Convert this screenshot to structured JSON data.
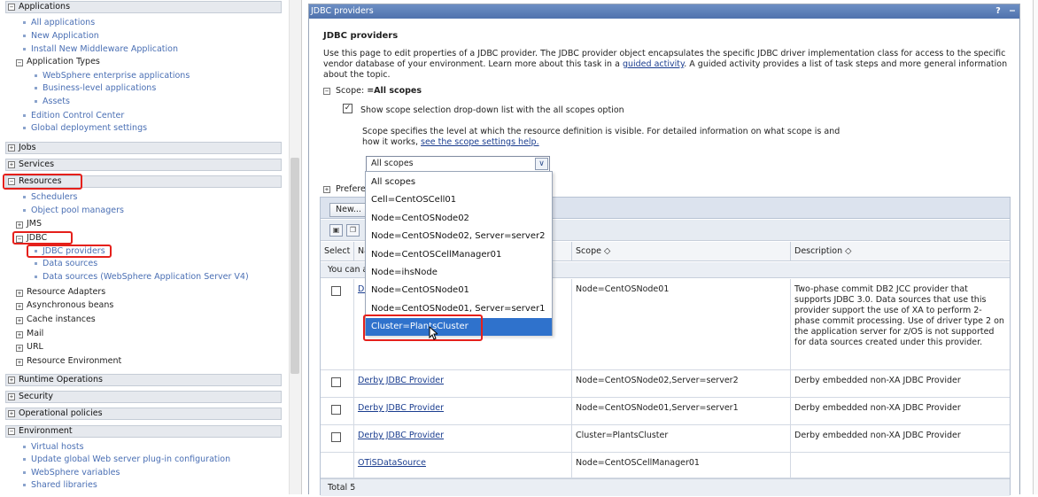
{
  "nav": {
    "applications": {
      "label": "Applications",
      "items": [
        "All applications",
        "New Application",
        "Install New Middleware Application"
      ],
      "app_types": {
        "label": "Application Types",
        "items": [
          "WebSphere enterprise applications",
          "Business-level applications",
          "Assets"
        ]
      },
      "more": [
        "Edition Control Center",
        "Global deployment settings"
      ]
    },
    "jobs": "Jobs",
    "services": "Services",
    "resources": {
      "label": "Resources",
      "items": [
        "Schedulers",
        "Object pool managers"
      ],
      "jms": "JMS",
      "jdbc": {
        "label": "JDBC",
        "items": [
          "JDBC providers",
          "Data sources",
          "Data sources (WebSphere Application Server V4)"
        ]
      },
      "groups": [
        "Resource Adapters",
        "Asynchronous beans",
        "Cache instances",
        "Mail",
        "URL",
        "Resource Environment"
      ]
    },
    "runtime_operations": "Runtime Operations",
    "security": "Security",
    "operational_policies": "Operational policies",
    "environment": {
      "label": "Environment",
      "items": [
        "Virtual hosts",
        "Update global Web server plug-in configuration",
        "WebSphere variables",
        "Shared libraries"
      ]
    }
  },
  "window": {
    "title": "JDBC providers",
    "help": "?",
    "minimize": "−"
  },
  "page": {
    "heading": "JDBC providers",
    "desc_1": "Use this page to edit properties of a JDBC provider. The JDBC provider object encapsulates the specific JDBC driver implementation class for access to the specific vendor database of your environment. Learn more about this task in a ",
    "desc_link": "guided activity",
    "desc_2": ". A guided activity provides a list of task steps and more general information about the topic.",
    "scope_label": "Scope:",
    "scope_value": "=All scopes",
    "scope_checkbox_label": "Show scope selection drop-down list with the all scopes option",
    "scope_help_1": "Scope specifies the level at which the resource definition is visible. For detailed information on what scope is and how it works, ",
    "scope_help_link": "see the scope settings help.",
    "scope_select_value": "All scopes",
    "preferences_label": "Prefere"
  },
  "dropdown": {
    "options": [
      "All scopes",
      "Cell=CentOSCell01",
      "Node=CentOSNode02",
      "Node=CentOSNode02, Server=server2",
      "Node=CentOSCellManager01",
      "Node=ihsNode",
      "Node=CentOSNode01",
      "Node=CentOSNode01, Server=server1",
      "Cluster=PlantsCluster"
    ],
    "selected": "Cluster=PlantsCluster"
  },
  "table": {
    "new_button": "New...",
    "headers": {
      "select": "Select",
      "name": "Na",
      "scope": "Scope",
      "description": "Description"
    },
    "note": "You can a",
    "rows": [
      {
        "name": "DB",
        "scope": "Node=CentOSNode01",
        "description": "Two-phase commit DB2 JCC provider that supports JDBC 3.0. Data sources that use this provider support the use of XA to perform 2-phase commit processing. Use of driver type 2 on the application server for z/OS is not supported for data sources created under this provider."
      },
      {
        "name": "Derby JDBC Provider",
        "scope": "Node=CentOSNode02,Server=server2",
        "description": "Derby embedded non-XA JDBC Provider"
      },
      {
        "name": "Derby JDBC Provider",
        "scope": "Node=CentOSNode01,Server=server1",
        "description": "Derby embedded non-XA JDBC Provider"
      },
      {
        "name": "Derby JDBC Provider",
        "scope": "Cluster=PlantsCluster",
        "description": "Derby embedded non-XA JDBC Provider"
      },
      {
        "name": "OTiSDataSource",
        "scope": "Node=CentOSCellManager01",
        "description": ""
      }
    ],
    "total": "Total 5"
  },
  "colors": {
    "highlight": "#e5201b",
    "titlebar": "#4f72ad",
    "selection": "#2f72cc",
    "link": "#1a3d8f"
  }
}
